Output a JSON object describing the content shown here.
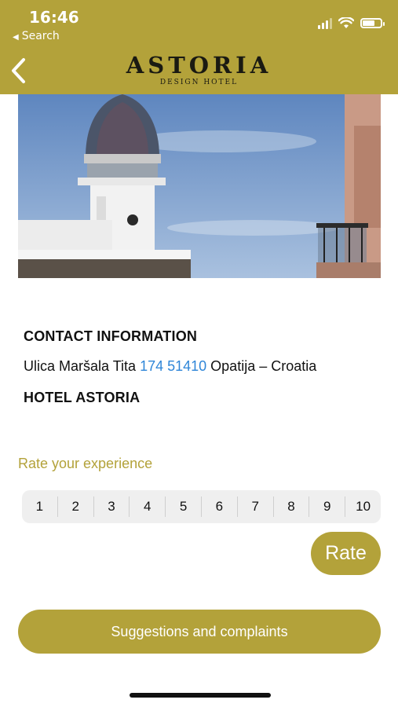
{
  "status_bar": {
    "time": "16:46",
    "back_app": "Search"
  },
  "header": {
    "logo_title": "ASTORIA",
    "logo_subtitle": "DESIGN HOTEL",
    "back_icon": "chevron-left-icon",
    "color": "#b3a23a"
  },
  "contact": {
    "heading": "CONTACT INFORMATION",
    "address_prefix": "Ulica Maršala Tita",
    "phone": "174 51410",
    "address_suffix": "Opatija – Croatia",
    "hotel_name": "HOTEL ASTORIA"
  },
  "rating": {
    "label": "Rate your experience",
    "options": [
      "1",
      "2",
      "3",
      "4",
      "5",
      "6",
      "7",
      "8",
      "9",
      "10"
    ],
    "button": "Rate"
  },
  "suggestions_button": "Suggestions and complaints",
  "colors": {
    "accent": "#b3a23a",
    "link": "#2f86d8"
  }
}
